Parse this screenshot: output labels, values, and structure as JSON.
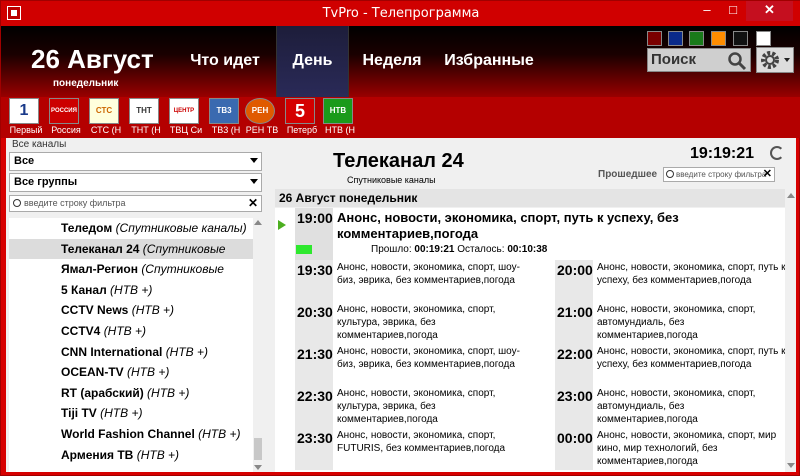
{
  "window": {
    "title": "TvPro - Телепрограмма",
    "min": "–",
    "max": "□",
    "close": "✕"
  },
  "header": {
    "date": "26 Август",
    "weekday": "понедельник",
    "tabs": [
      "Что идет",
      "День",
      "Неделя",
      "Избранные"
    ],
    "active_tab": "День",
    "swatches": [
      "#7a0000",
      "#0a2a8a",
      "#1a7a1a",
      "#ff8c00",
      "#111111",
      "#ffffff"
    ],
    "search_label": "Поиск"
  },
  "channels": [
    {
      "label": "Первый",
      "logo": "1"
    },
    {
      "label": "Россия",
      "logo": "РОССИЯ 1"
    },
    {
      "label": "СТС (Н",
      "logo": "СТС"
    },
    {
      "label": "ТНТ (Н",
      "logo": "ТНТ"
    },
    {
      "label": "ТВЦ Си",
      "logo": "ЦЕНТР"
    },
    {
      "label": "ТВ3 (Н",
      "logo": "ТВ3"
    },
    {
      "label": "РЕН ТВ",
      "logo": "РЕН"
    },
    {
      "label": "Петерб",
      "logo": "5"
    },
    {
      "label": "НТВ (Н",
      "logo": "НТВ"
    }
  ],
  "left": {
    "all_channels_label": "Все каналы",
    "combo1": "Все",
    "combo2": "Все группы",
    "filter_placeholder": "введите строку фильтра",
    "items": [
      {
        "name": "Теледом",
        "tag": "(Спутниковые каналы)"
      },
      {
        "name": "Телеканал  24",
        "tag": "(Спутниковые"
      },
      {
        "name": "Ямал-Регион",
        "tag": "(Спутниковые"
      },
      {
        "name": "5 Канал",
        "tag": "(НТВ +)"
      },
      {
        "name": "CCTV News",
        "tag": "(НТВ +)"
      },
      {
        "name": "CCTV4",
        "tag": "(НТВ +)"
      },
      {
        "name": "CNN International",
        "tag": "(НТВ +)"
      },
      {
        "name": "OCEAN-TV",
        "tag": "(НТВ +)"
      },
      {
        "name": "RT (арабский)",
        "tag": "(НТВ +)"
      },
      {
        "name": "Tiji TV",
        "tag": "(НТВ +)"
      },
      {
        "name": "World Fashion Channel",
        "tag": "(НТВ +)"
      },
      {
        "name": "Армения ТВ",
        "tag": "(НТВ +)"
      }
    ],
    "selected_index": 1
  },
  "right": {
    "channel_name": "Телеканал  24",
    "channel_group": "Спутниковые каналы",
    "clock": "19:19:21",
    "past_label": "Прошедшее",
    "filter_placeholder": "введите строку фильтра",
    "day_header": "26 Август понедельник",
    "current": {
      "time": "19:00",
      "title": "Анонс, новости, экономика, спорт, путь к успеху, без комментариев,погода",
      "passed_label": "Прошло:",
      "passed": "00:19:21",
      "left_label": "Осталось:",
      "left": "00:10:38",
      "progress": 0.645
    },
    "schedule": [
      {
        "time": "19:30",
        "text": "Анонс, новости, экономика, спорт, шоу-биз, эврика, без комментариев,погода"
      },
      {
        "time": "20:00",
        "text": "Анонс, новости, экономика, спорт, путь к успеху, без комментариев,погода"
      },
      {
        "time": "20:30",
        "text": "Анонс, новости, экономика, спорт, культура, эврика, без комментариев,погода"
      },
      {
        "time": "21:00",
        "text": "Анонс, новости, экономика, спорт, автомундиаль, без комментариев,погода"
      },
      {
        "time": "21:30",
        "text": "Анонс, новости, экономика, спорт, шоу-биз, эврика, без комментариев,погода"
      },
      {
        "time": "22:00",
        "text": "Анонс, новости, экономика, спорт, путь к успеху, без комментариев,погода"
      },
      {
        "time": "22:30",
        "text": "Анонс, новости, экономика, спорт, культура, эврика, без комментариев,погода"
      },
      {
        "time": "23:00",
        "text": "Анонс, новости, экономика, спорт, автомундиаль, без комментариев,погода"
      },
      {
        "time": "23:30",
        "text": "Анонс, новости, экономика, спорт, FUTURIS, без комментариев,погода"
      },
      {
        "time": "00:00",
        "text": "Анонс, новости, экономика, спорт, мир кино, мир технологий, без комментариев,погода"
      }
    ]
  }
}
